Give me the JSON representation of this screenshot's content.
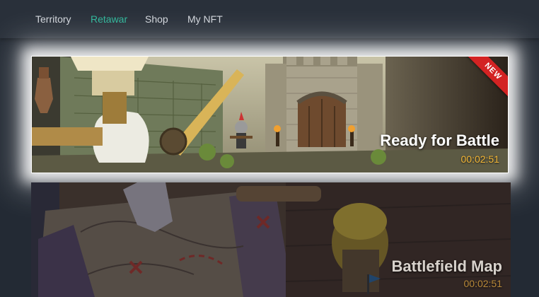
{
  "nav": {
    "items": [
      {
        "label": "Territory",
        "active": false
      },
      {
        "label": "Retawar",
        "active": true
      },
      {
        "label": "Shop",
        "active": false
      },
      {
        "label": "My NFT",
        "active": false
      }
    ],
    "active_color": "#2fb69a"
  },
  "cards": [
    {
      "title": "Ready for Battle",
      "timer": "00:02:51",
      "badge": "NEW",
      "highlighted": true
    },
    {
      "title": "Battlefield Map",
      "timer": "00:02:51",
      "highlighted": false
    }
  ],
  "colors": {
    "timer": "#f2b637",
    "badge": "#d32323",
    "background": "#232a34"
  }
}
